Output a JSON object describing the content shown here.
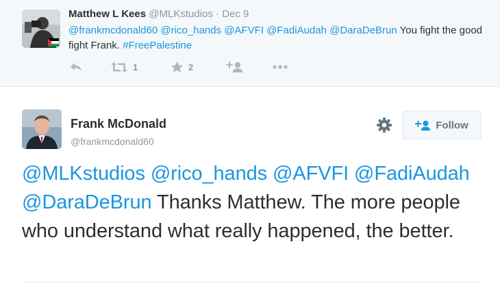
{
  "parent_tweet": {
    "name": "Matthew L Kees",
    "handle": "@MLKstudios",
    "separator": "·",
    "time": "Dec 9",
    "text_parts": [
      {
        "type": "link",
        "text": "@frankmcdonald60"
      },
      {
        "type": "text",
        "text": " "
      },
      {
        "type": "link",
        "text": "@rico_hands"
      },
      {
        "type": "text",
        "text": " "
      },
      {
        "type": "link",
        "text": "@AFVFI"
      },
      {
        "type": "text",
        "text": " "
      },
      {
        "type": "link",
        "text": "@FadiAudah"
      },
      {
        "type": "text",
        "text": " "
      },
      {
        "type": "link",
        "text": "@DaraDeBrun"
      },
      {
        "type": "text",
        "text": " You fight the good fight Frank. "
      },
      {
        "type": "link",
        "text": "#FreePalestine"
      }
    ],
    "actions": {
      "reply": {
        "icon": "reply-icon"
      },
      "retweet": {
        "icon": "retweet-icon",
        "count": "1"
      },
      "favorite": {
        "icon": "star-icon",
        "count": "2"
      },
      "follow": {
        "icon": "add-user-icon"
      },
      "more": {
        "icon": "more-icon"
      }
    }
  },
  "main_tweet": {
    "name": "Frank McDonald",
    "handle": "@frankmcdonald60",
    "settings_icon": "gear-icon",
    "follow_label": "Follow",
    "text_parts": [
      {
        "type": "link",
        "text": "@MLKstudios"
      },
      {
        "type": "text",
        "text": " "
      },
      {
        "type": "link",
        "text": "@rico_hands"
      },
      {
        "type": "text",
        "text": " "
      },
      {
        "type": "link",
        "text": "@AFVFI"
      },
      {
        "type": "text",
        "text": " "
      },
      {
        "type": "link",
        "text": "@FadiAudah"
      },
      {
        "type": "text",
        "text": " "
      },
      {
        "type": "link",
        "text": "@DaraDeBrun"
      },
      {
        "type": "text",
        "text": " Thanks Matthew. The more people who understand what really happened, the better."
      }
    ]
  },
  "colors": {
    "link": "#1b95e0",
    "text": "#292f33",
    "muted": "#8899a6",
    "icon": "#aab8c2",
    "parent_bg": "#f5f8fa"
  }
}
